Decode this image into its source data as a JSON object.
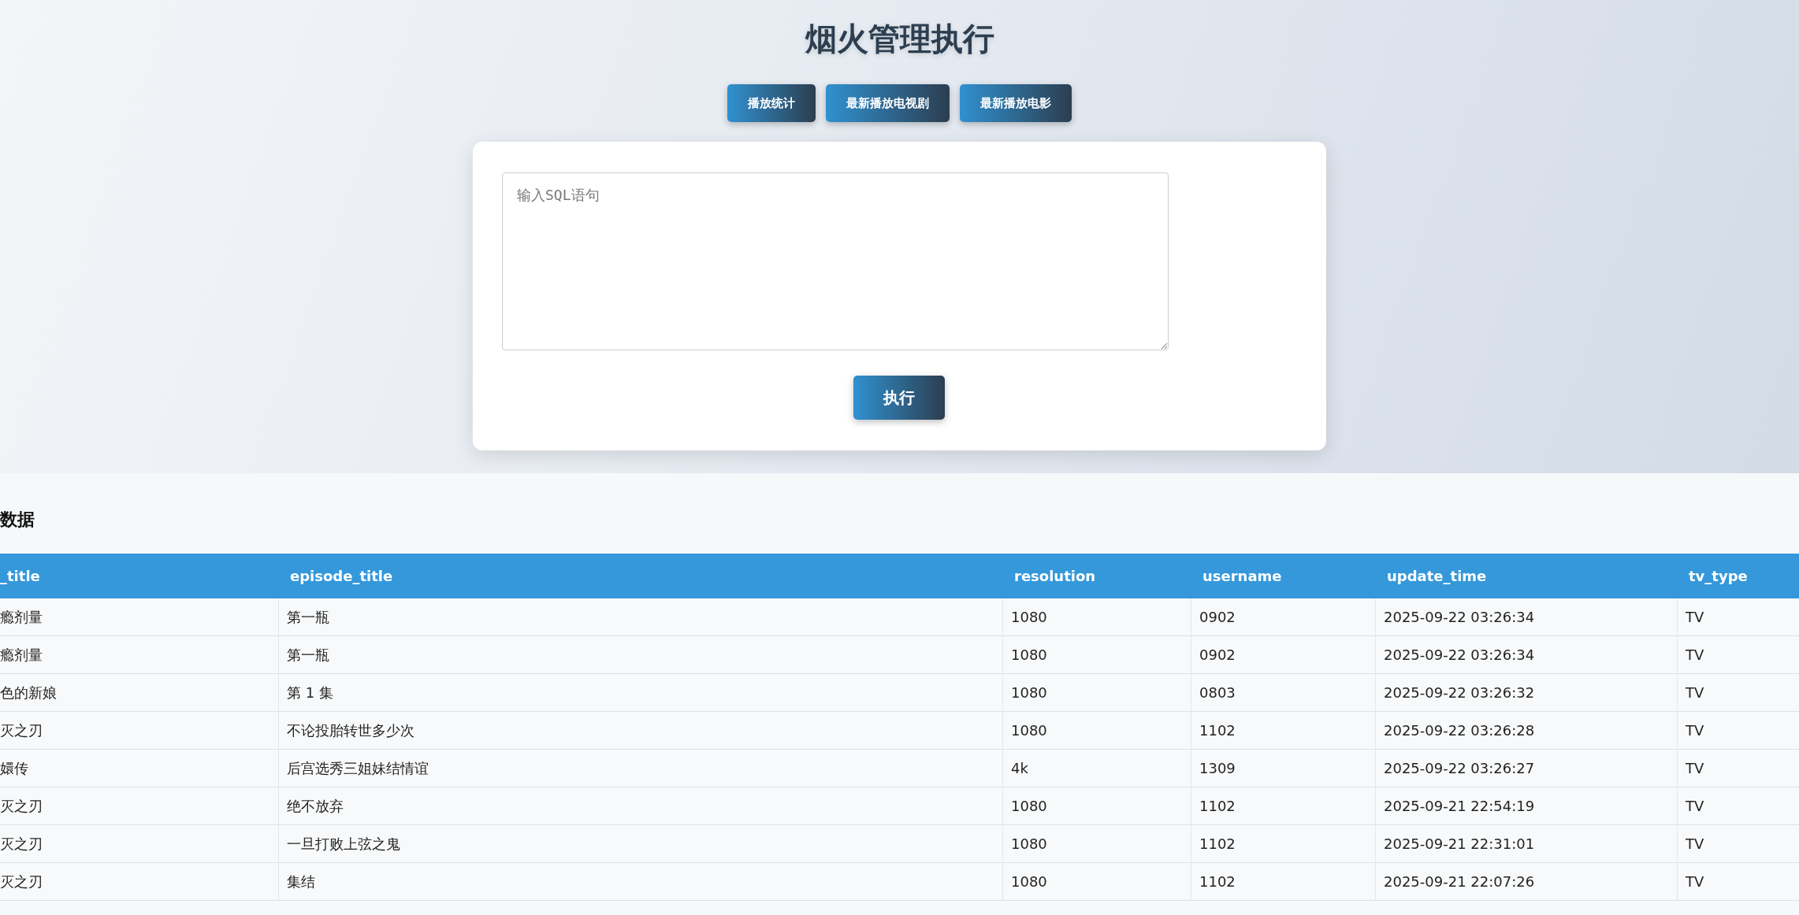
{
  "title": "烟火管理执行",
  "nav_buttons": [
    "播放统计",
    "最新播放电视剧",
    "最新播放电影"
  ],
  "sql_input": {
    "placeholder": "输入SQL语句"
  },
  "execute_button": "执行",
  "results": {
    "heading": "数据",
    "columns": [
      "_title",
      "episode_title",
      "resolution",
      "username",
      "update_time",
      "tv_type"
    ],
    "rows": [
      [
        "瘾剂量",
        "第一瓶",
        "1080",
        "0902",
        "2025-09-22 03:26:34",
        "TV"
      ],
      [
        "瘾剂量",
        "第一瓶",
        "1080",
        "0902",
        "2025-09-22 03:26:34",
        "TV"
      ],
      [
        "色的新娘",
        "第 1 集",
        "1080",
        "0803",
        "2025-09-22 03:26:32",
        "TV"
      ],
      [
        "灭之刃",
        "不论投胎转世多少次",
        "1080",
        "1102",
        "2025-09-22 03:26:28",
        "TV"
      ],
      [
        "嬛传",
        "后宫选秀三姐妹结情谊",
        "4k",
        "1309",
        "2025-09-22 03:26:27",
        "TV"
      ],
      [
        "灭之刃",
        "绝不放弃",
        "1080",
        "1102",
        "2025-09-21 22:54:19",
        "TV"
      ],
      [
        "灭之刃",
        "一旦打败上弦之鬼",
        "1080",
        "1102",
        "2025-09-21 22:31:01",
        "TV"
      ],
      [
        "灭之刃",
        "集结",
        "1080",
        "1102",
        "2025-09-21 22:07:26",
        "TV"
      ]
    ]
  }
}
